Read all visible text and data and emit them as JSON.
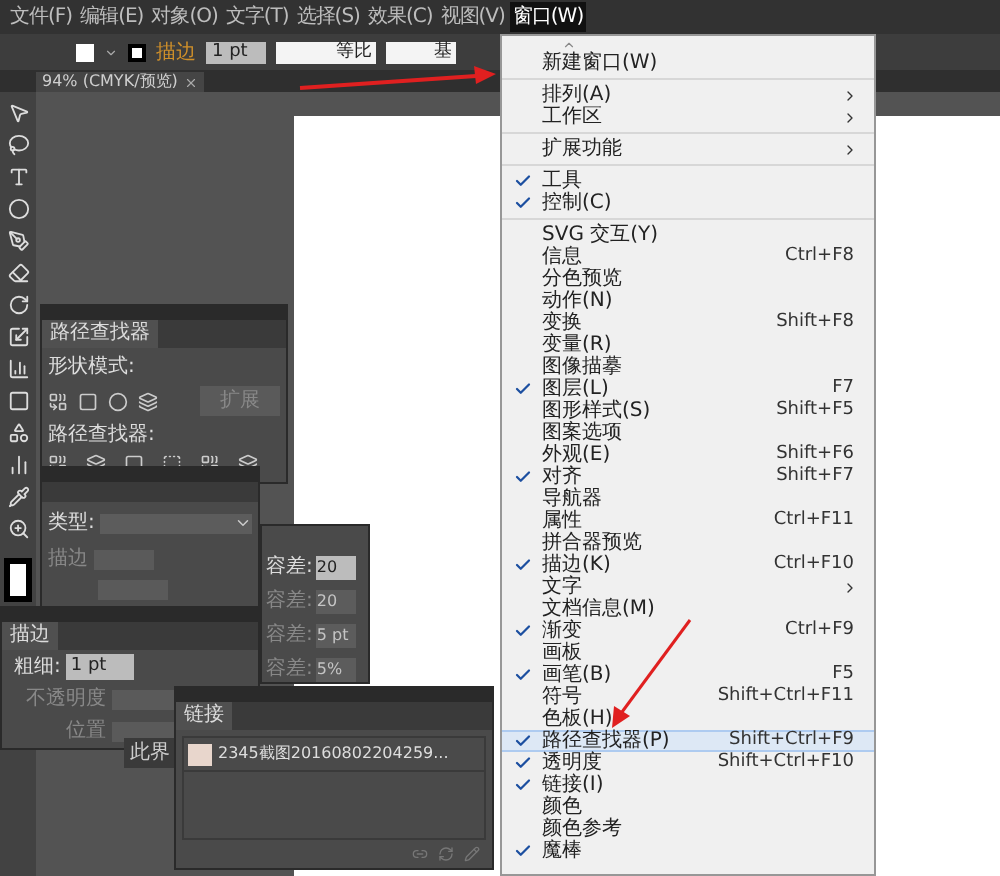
{
  "menu_bar": [
    {
      "label": "文件(F)",
      "selected": false
    },
    {
      "label": "编辑(E)",
      "selected": false
    },
    {
      "label": "对象(O)",
      "selected": false
    },
    {
      "label": "文字(T)",
      "selected": false
    },
    {
      "label": "选择(S)",
      "selected": false
    },
    {
      "label": "效果(C)",
      "selected": false
    },
    {
      "label": "视图(V)",
      "selected": false
    },
    {
      "label": "窗口(W)",
      "selected": true
    }
  ],
  "control_bar": {
    "stroke_label": "描边",
    "stroke_weight": "1 pt",
    "profile_1": "等比",
    "profile_2": "基"
  },
  "document_tab": {
    "title": "94% (CMYK/预览)"
  },
  "pathfinder_panel": {
    "tab": "路径查找器",
    "shape_modes_label": "形状模式:",
    "expand_button": "扩展",
    "pathfinders_label": "路径查找器:"
  },
  "gradient_panel": {
    "type_label": "类型:",
    "stroke_label": "描边"
  },
  "tolerance_panel": {
    "fields": [
      {
        "label": "容差:",
        "value": "20",
        "disabled": false
      },
      {
        "label": "容差:",
        "value": "20",
        "disabled": true
      },
      {
        "label": "容差:",
        "value": "5 pt",
        "disabled": true
      },
      {
        "label": "容差:",
        "value": "5%",
        "disabled": true
      }
    ]
  },
  "stroke_panel": {
    "tab": "描边",
    "weight_label": "粗细:",
    "weight_value": "1 pt",
    "opacity_label": "不透明度",
    "position_label": "位置"
  },
  "collapsed_tab": "此界",
  "links_panel": {
    "tab": "链接",
    "items": [
      {
        "name": "2345截图20160802204259..."
      }
    ]
  },
  "window_menu": {
    "groups": [
      {
        "items": [
          {
            "label": "新建窗口(W)",
            "checked": false,
            "submenu": false,
            "highlighted": false
          }
        ]
      },
      {
        "items": [
          {
            "label": "排列(A)",
            "checked": false,
            "submenu": true,
            "highlighted": false
          },
          {
            "label": "工作区",
            "checked": false,
            "submenu": true,
            "highlighted": false
          }
        ]
      },
      {
        "items": [
          {
            "label": "扩展功能",
            "checked": false,
            "submenu": true,
            "highlighted": false
          }
        ]
      },
      {
        "items": [
          {
            "label": "工具",
            "checked": true,
            "submenu": false,
            "highlighted": false
          },
          {
            "label": "控制(C)",
            "checked": true,
            "submenu": false,
            "highlighted": false
          }
        ]
      },
      {
        "items": [
          {
            "label": "SVG 交互(Y)",
            "checked": false,
            "submenu": false,
            "highlighted": false
          },
          {
            "label": "信息",
            "shortcut": "Ctrl+F8",
            "checked": false,
            "submenu": false,
            "highlighted": false
          },
          {
            "label": "分色预览",
            "checked": false,
            "submenu": false,
            "highlighted": false
          },
          {
            "label": "动作(N)",
            "checked": false,
            "submenu": false,
            "highlighted": false
          },
          {
            "label": "变换",
            "shortcut": "Shift+F8",
            "checked": false,
            "submenu": false,
            "highlighted": false
          },
          {
            "label": "变量(R)",
            "checked": false,
            "submenu": false,
            "highlighted": false
          },
          {
            "label": "图像描摹",
            "checked": false,
            "submenu": false,
            "highlighted": false
          },
          {
            "label": "图层(L)",
            "shortcut": "F7",
            "checked": true,
            "submenu": false,
            "highlighted": false
          },
          {
            "label": "图形样式(S)",
            "shortcut": "Shift+F5",
            "checked": false,
            "submenu": false,
            "highlighted": false
          },
          {
            "label": "图案选项",
            "checked": false,
            "submenu": false,
            "highlighted": false
          },
          {
            "label": "外观(E)",
            "shortcut": "Shift+F6",
            "checked": false,
            "submenu": false,
            "highlighted": false
          },
          {
            "label": "对齐",
            "shortcut": "Shift+F7",
            "checked": true,
            "submenu": false,
            "highlighted": false
          },
          {
            "label": "导航器",
            "checked": false,
            "submenu": false,
            "highlighted": false
          },
          {
            "label": "属性",
            "shortcut": "Ctrl+F11",
            "checked": false,
            "submenu": false,
            "highlighted": false
          },
          {
            "label": "拼合器预览",
            "checked": false,
            "submenu": false,
            "highlighted": false
          },
          {
            "label": "描边(K)",
            "shortcut": "Ctrl+F10",
            "checked": true,
            "submenu": false,
            "highlighted": false
          },
          {
            "label": "文字",
            "checked": false,
            "submenu": true,
            "highlighted": false
          },
          {
            "label": "文档信息(M)",
            "checked": false,
            "submenu": false,
            "highlighted": false
          },
          {
            "label": "渐变",
            "shortcut": "Ctrl+F9",
            "checked": true,
            "submenu": false,
            "highlighted": false
          },
          {
            "label": "画板",
            "checked": false,
            "submenu": false,
            "highlighted": false
          },
          {
            "label": "画笔(B)",
            "shortcut": "F5",
            "checked": true,
            "submenu": false,
            "highlighted": false
          },
          {
            "label": "符号",
            "shortcut": "Shift+Ctrl+F11",
            "checked": false,
            "submenu": false,
            "highlighted": false
          },
          {
            "label": "色板(H)",
            "checked": false,
            "submenu": false,
            "highlighted": false
          },
          {
            "label": "路径查找器(P)",
            "shortcut": "Shift+Ctrl+F9",
            "checked": true,
            "submenu": false,
            "highlighted": true
          },
          {
            "label": "透明度",
            "shortcut": "Shift+Ctrl+F10",
            "checked": true,
            "submenu": false,
            "highlighted": false
          },
          {
            "label": "链接(I)",
            "checked": true,
            "submenu": false,
            "highlighted": false
          },
          {
            "label": "颜色",
            "checked": false,
            "submenu": false,
            "highlighted": false
          },
          {
            "label": "颜色参考",
            "checked": false,
            "submenu": false,
            "highlighted": false
          },
          {
            "label": "魔棒",
            "checked": true,
            "submenu": false,
            "highlighted": false
          }
        ]
      }
    ]
  }
}
